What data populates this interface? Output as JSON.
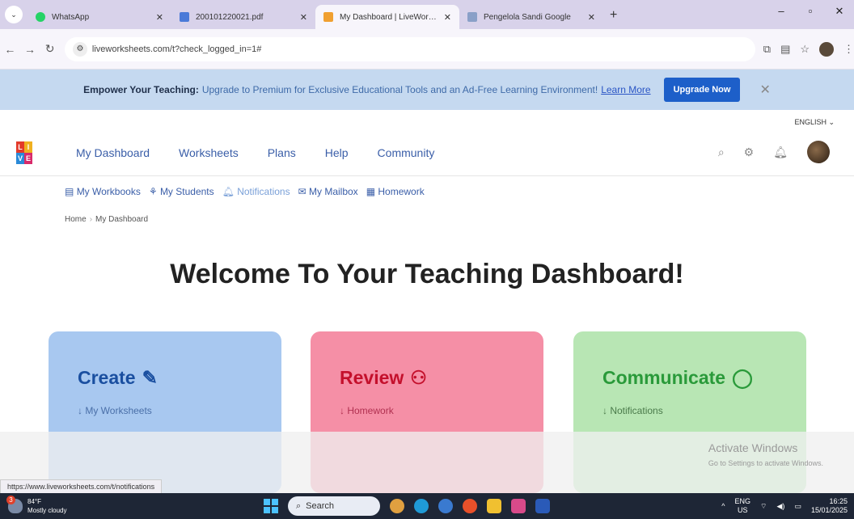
{
  "browser": {
    "tabs": [
      {
        "label": "WhatsApp",
        "color": "#25d366"
      },
      {
        "label": "200101220021.pdf",
        "color": "#4a7ad8"
      },
      {
        "label": "My Dashboard | LiveWorksheets",
        "color": "#f0a030",
        "active": true
      },
      {
        "label": "Pengelola Sandi Google",
        "color": "#8aa0c8"
      }
    ],
    "new_tab": "+",
    "url": "liveworksheets.com/t?check_logged_in=1#"
  },
  "promo": {
    "lead": "Empower Your Teaching:",
    "text": "Upgrade to Premium for Exclusive Educational Tools and an Ad-Free Learning Environment!",
    "learn_more": "Learn More",
    "upgrade_button": "Upgrade Now",
    "close": "✕"
  },
  "header": {
    "language": "ENGLISH ⌄",
    "logo_letters": [
      "L",
      "I",
      "V",
      "E"
    ],
    "nav": [
      "My Dashboard",
      "Worksheets",
      "Plans",
      "Help",
      "Community"
    ]
  },
  "subnav": [
    {
      "icon": "▤",
      "label": "My Workbooks"
    },
    {
      "icon": "⚘",
      "label": "My Students"
    },
    {
      "icon": "🔔︎",
      "label": "Notifications"
    },
    {
      "icon": "✉",
      "label": "My Mailbox"
    },
    {
      "icon": "▦",
      "label": "Homework"
    }
  ],
  "breadcrumb": {
    "home": "Home",
    "current": "My Dashboard"
  },
  "welcome": "Welcome To Your Teaching Dashboard!",
  "cards": {
    "create": {
      "title": "Create",
      "icon": "✎",
      "items": [
        "My Worksheets"
      ]
    },
    "review": {
      "title": "Review",
      "icon": "⚇",
      "items": [
        "Homework"
      ]
    },
    "communicate": {
      "title": "Communicate",
      "icon": "◯",
      "items": [
        "Notifications"
      ]
    }
  },
  "activate": {
    "line1": "Activate Windows",
    "line2": "Go to Settings to activate Windows."
  },
  "status_url": "https://www.liveworksheets.com/t/notifications",
  "taskbar": {
    "weather_temp": "84°F",
    "weather_desc": "Mostly cloudy",
    "search": "Search",
    "lang_top": "ENG",
    "lang_bottom": "US",
    "time": "16:25",
    "date": "15/01/2025"
  }
}
